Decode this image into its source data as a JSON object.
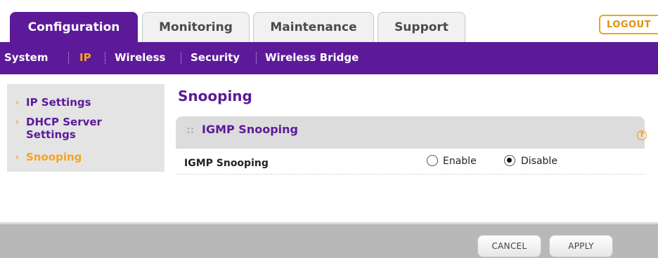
{
  "top_tabs": [
    {
      "label": "Configuration",
      "active": true
    },
    {
      "label": "Monitoring",
      "active": false
    },
    {
      "label": "Maintenance",
      "active": false
    },
    {
      "label": "Support",
      "active": false
    }
  ],
  "logout_label": "LOGOUT",
  "subnav": {
    "items": [
      {
        "label": "System",
        "active": false
      },
      {
        "label": "IP",
        "active": true
      },
      {
        "label": "Wireless",
        "active": false
      },
      {
        "label": "Security",
        "active": false
      },
      {
        "label": "Wireless Bridge",
        "active": false
      }
    ]
  },
  "left_menu": {
    "items": [
      {
        "label": "IP Settings",
        "active": false
      },
      {
        "label": "DHCP Server Settings",
        "active": false
      },
      {
        "label": "Snooping",
        "active": true
      }
    ]
  },
  "page_title": "Snooping",
  "section": {
    "title": "IGMP Snooping",
    "help_icon": "help-icon",
    "field": {
      "label": "IGMP Snooping",
      "options": [
        {
          "label": "Enable",
          "selected": false
        },
        {
          "label": "Disable",
          "selected": true
        }
      ]
    }
  },
  "footer": {
    "cancel_label": "CANCEL",
    "apply_label": "APPLY"
  },
  "colors": {
    "brand_purple": "#5c1a99",
    "accent_orange": "#f7a51c"
  }
}
